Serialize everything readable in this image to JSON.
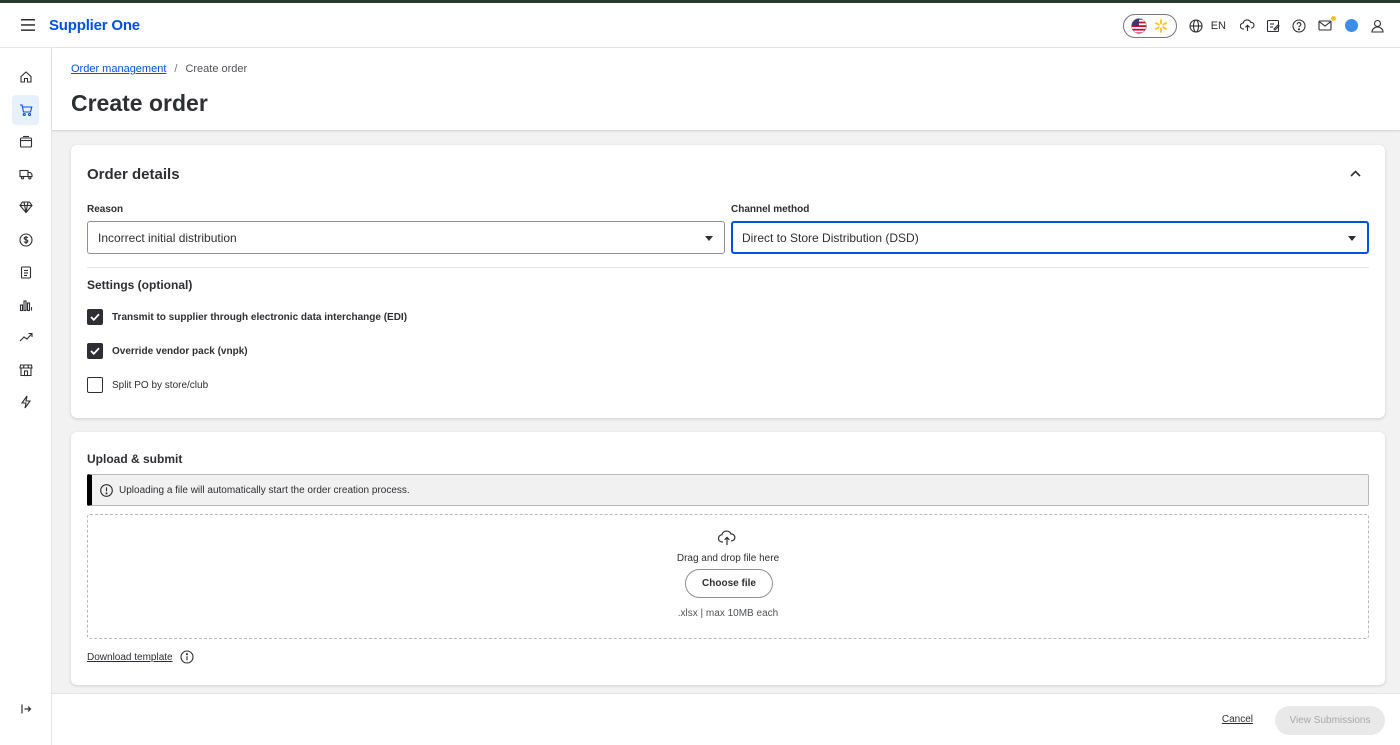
{
  "app": {
    "brand": "Supplier One"
  },
  "topbar": {
    "language": "EN"
  },
  "breadcrumb": {
    "parent": "Order management",
    "separator": "/",
    "current": "Create order"
  },
  "page": {
    "title": "Create order"
  },
  "order_details": {
    "title": "Order details",
    "reason_label": "Reason",
    "reason_value": "Incorrect initial distribution",
    "channel_label": "Channel method",
    "channel_value": "Direct to Store Distribution (DSD)",
    "settings_title": "Settings (optional)",
    "settings": [
      {
        "label": "Transmit to supplier through electronic data interchange (EDI)",
        "checked": true
      },
      {
        "label": "Override vendor pack (vnpk)",
        "checked": true
      },
      {
        "label": "Split PO by store/club",
        "checked": false
      }
    ]
  },
  "upload": {
    "title": "Upload & submit",
    "banner": "Uploading a file will automatically start the order creation process.",
    "drop_text": "Drag and drop file here",
    "choose_label": "Choose file",
    "hint": ".xlsx | max 10MB each",
    "download_label": "Download template"
  },
  "footer": {
    "cancel_label": "Cancel",
    "view_label": "View Submissions"
  },
  "colors": {
    "brand": "#0053e2",
    "focus": "#0053e2",
    "active_bg": "#e6f1fc"
  }
}
